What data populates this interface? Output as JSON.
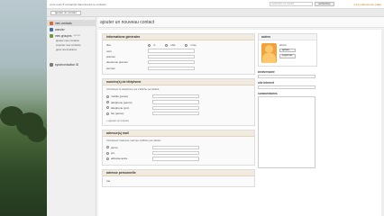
{
  "topbar": {
    "info": "vous a ete 8 contact(s) dans Evolve le contacts",
    "search_placeholder": "rechercher un contact",
    "search_button": "rechercher",
    "links": "mes preferences | aide"
  },
  "toolbar": {
    "add_contact": "ajouter un contact"
  },
  "sidebar": {
    "items": [
      {
        "label": "mes contacts",
        "color": "#d86b2a"
      },
      {
        "label": "annuler",
        "color": "#3b6fb0"
      },
      {
        "label": "mes groupes",
        "tag": "ajouter",
        "color": "#6a9a3c"
      }
    ],
    "subs": [
      "ajouter mes contacts",
      "exporter mes contacts",
      "gérer les doublons"
    ],
    "bottom": {
      "label": "synchronisation ID",
      "color": "#7a7a7a"
    }
  },
  "main": {
    "title": "ajouter un nouveau contact",
    "general": {
      "title": "informations générales",
      "titre_label": "titre",
      "radios": [
        "m",
        "mlle",
        "mme"
      ],
      "fields": [
        "nom",
        "prénom",
        "deuxième prénom",
        "surnom"
      ]
    },
    "phone": {
      "title": "numéro(s) de téléphone",
      "desc": "Choisissez le téléphone qui s'affiche par défaut.",
      "items": [
        "mobile (perso)",
        "téléphone (perso)",
        "téléphone (pro)",
        "fax (perso)"
      ],
      "add": "+ ajouter un numéro"
    },
    "email": {
      "title": "adresse(s) mail",
      "desc": "Choisissez l'adresse mail qui s'affiche par défaut.",
      "items": [
        "perso",
        "pro",
        "adresse autre"
      ]
    },
    "address": {
      "title": "adresse personnelle",
      "fields": [
        "rue"
      ]
    }
  },
  "right": {
    "photo_title": "autres",
    "photo_name": "photo",
    "buttons": [
      "ajouter",
      "supprimer"
    ],
    "anniversary": "anniversaire",
    "website": "site Internet",
    "comments": "commentaires"
  }
}
